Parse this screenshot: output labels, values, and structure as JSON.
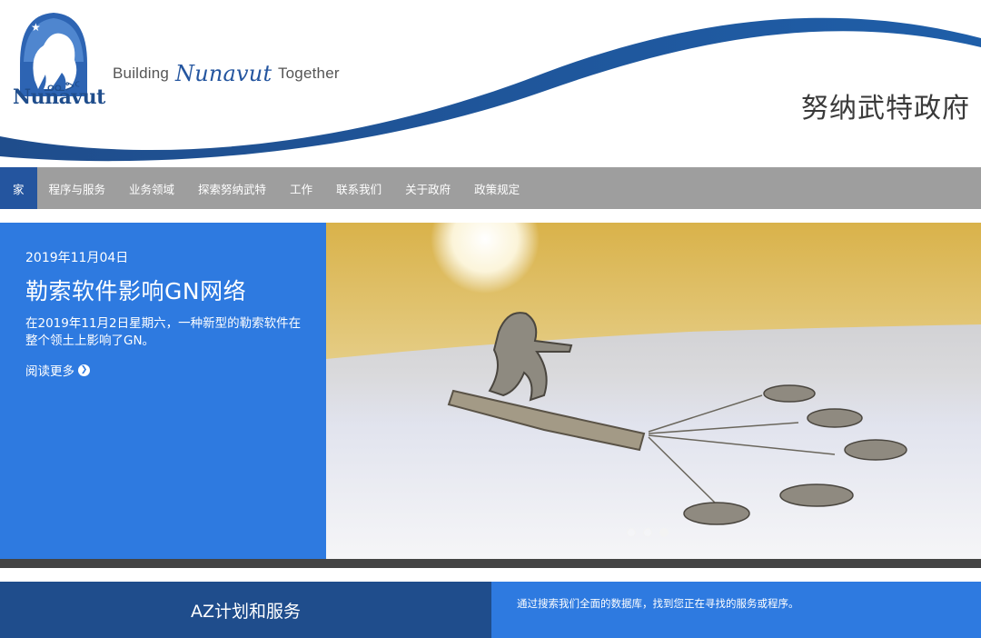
{
  "header": {
    "logo_text": "Nunavut",
    "tagline_pre": "Building",
    "tagline_brand": "Nunavut",
    "tagline_post": "Together",
    "gov_title": "努纳武特政府"
  },
  "nav": {
    "items": [
      {
        "label": "家",
        "active": true
      },
      {
        "label": "程序与服务"
      },
      {
        "label": "业务领域"
      },
      {
        "label": "探索努纳武特"
      },
      {
        "label": "工作"
      },
      {
        "label": "联系我们"
      },
      {
        "label": "关于政府"
      },
      {
        "label": "政策规定"
      }
    ]
  },
  "hero": {
    "date": "2019年11月04日",
    "title": "勒索软件影响GN网络",
    "description": "在2019年11月2日星期六，一种新型的勒索软件在整个领土上影响了GN。",
    "read_more": "阅读更多",
    "carousel": {
      "slides": 3,
      "active_slide": 3
    }
  },
  "az": {
    "label": "AZ计划和服务"
  },
  "search_promo": {
    "text": "通过搜索我们全面的数据库，找到您正在寻找的服务或程序。"
  },
  "colors": {
    "primary_blue": "#2e7ae0",
    "dark_blue": "#1f4d8c",
    "nav_gray": "#9e9e9e",
    "active_nav": "#24559f"
  }
}
